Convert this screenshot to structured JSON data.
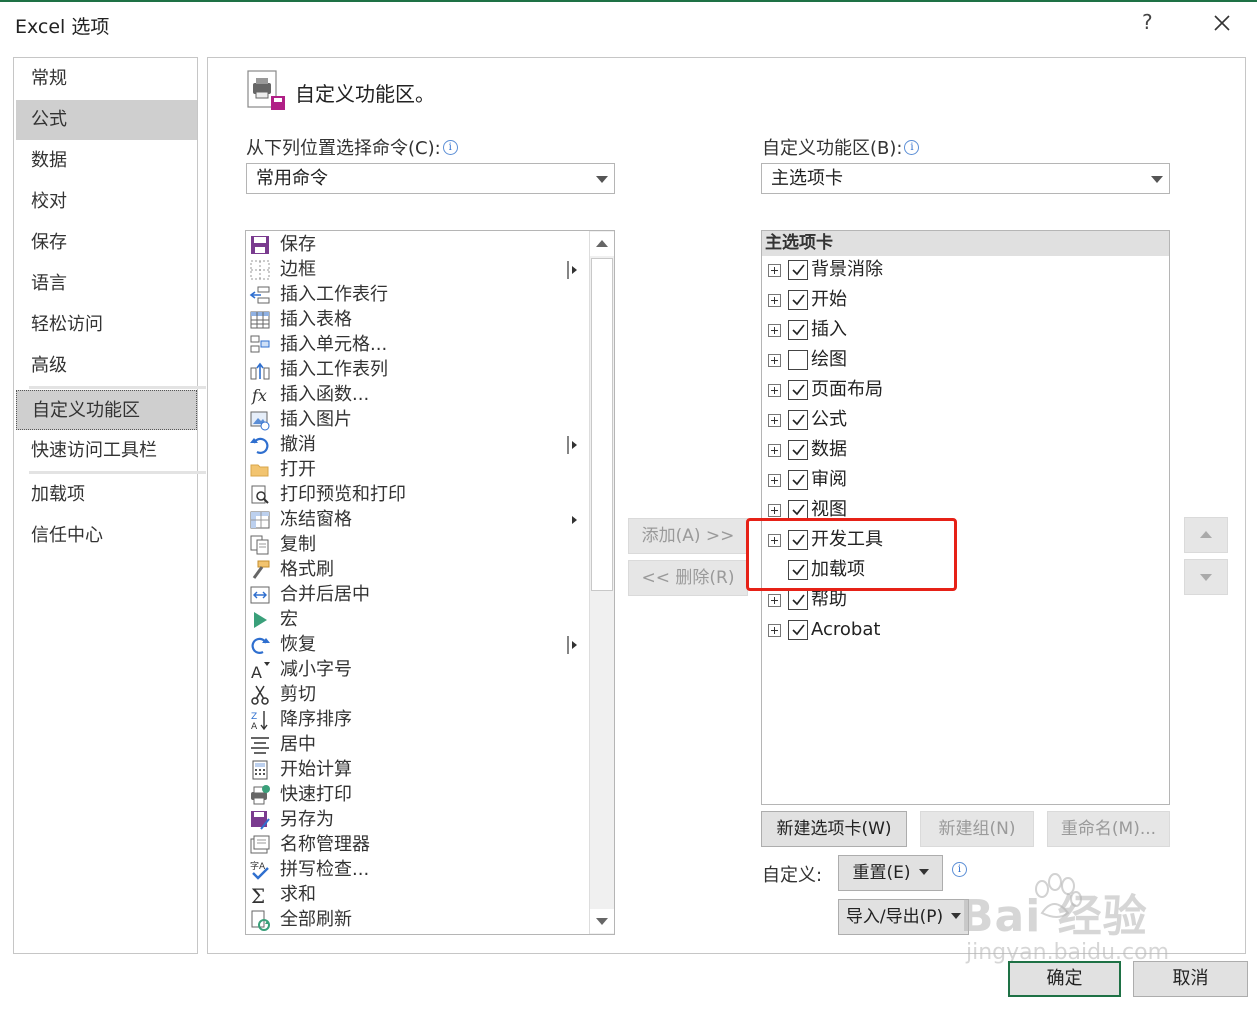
{
  "window": {
    "title": "Excel 选项",
    "help": "?"
  },
  "sidebar": {
    "items": [
      {
        "label": "常规"
      },
      {
        "label": "公式"
      },
      {
        "label": "数据"
      },
      {
        "label": "校对"
      },
      {
        "label": "保存"
      },
      {
        "label": "语言"
      },
      {
        "label": "轻松访问"
      },
      {
        "label": "高级"
      },
      {
        "label": "自定义功能区"
      },
      {
        "label": "快速访问工具栏"
      },
      {
        "label": "加载项"
      },
      {
        "label": "信任中心"
      }
    ]
  },
  "header": {
    "title": "自定义功能区。",
    "icon": "customize-ribbon-icon"
  },
  "left_panel": {
    "choose_label": "从下列位置选择命令(C):",
    "choose_value": "常用命令",
    "commands": [
      {
        "label": "保存",
        "icon": "save-icon"
      },
      {
        "label": "边框",
        "icon": "borders-icon",
        "submenu": "split"
      },
      {
        "label": "插入工作表行",
        "icon": "insert-sheet-rows-icon"
      },
      {
        "label": "插入表格",
        "icon": "insert-table-icon"
      },
      {
        "label": "插入单元格...",
        "icon": "insert-cells-icon"
      },
      {
        "label": "插入工作表列",
        "icon": "insert-sheet-columns-icon"
      },
      {
        "label": "插入函数...",
        "icon": "insert-function-icon"
      },
      {
        "label": "插入图片",
        "icon": "insert-picture-icon"
      },
      {
        "label": "撤消",
        "icon": "undo-icon",
        "submenu": "split"
      },
      {
        "label": "打开",
        "icon": "open-folder-icon"
      },
      {
        "label": "打印预览和打印",
        "icon": "print-preview-icon"
      },
      {
        "label": "冻结窗格",
        "icon": "freeze-panes-icon",
        "submenu": "arrow"
      },
      {
        "label": "复制",
        "icon": "copy-icon"
      },
      {
        "label": "格式刷",
        "icon": "format-painter-icon"
      },
      {
        "label": "合并后居中",
        "icon": "merge-center-icon"
      },
      {
        "label": "宏",
        "icon": "macro-icon"
      },
      {
        "label": "恢复",
        "icon": "redo-icon",
        "submenu": "split"
      },
      {
        "label": "减小字号",
        "icon": "decrease-font-icon"
      },
      {
        "label": "剪切",
        "icon": "cut-icon"
      },
      {
        "label": "降序排序",
        "icon": "sort-descending-icon"
      },
      {
        "label": "居中",
        "icon": "center-align-icon"
      },
      {
        "label": "开始计算",
        "icon": "calculate-icon"
      },
      {
        "label": "快速打印",
        "icon": "quick-print-icon"
      },
      {
        "label": "另存为",
        "icon": "save-as-icon"
      },
      {
        "label": "名称管理器",
        "icon": "name-manager-icon"
      },
      {
        "label": "拼写检查...",
        "icon": "spelling-icon"
      },
      {
        "label": "求和",
        "icon": "sum-icon"
      },
      {
        "label": "全部刷新",
        "icon": "refresh-all-icon"
      }
    ]
  },
  "middle": {
    "add_label": "添加(A) >>",
    "remove_label": "<< 删除(R)"
  },
  "right_panel": {
    "customize_label": "自定义功能区(B):",
    "customize_value": "主选项卡",
    "tree_header": "主选项卡",
    "tabs": [
      {
        "label": "背景消除",
        "checked": true,
        "expander": true
      },
      {
        "label": "开始",
        "checked": true,
        "expander": true
      },
      {
        "label": "插入",
        "checked": true,
        "expander": true
      },
      {
        "label": "绘图",
        "checked": false,
        "expander": true
      },
      {
        "label": "页面布局",
        "checked": true,
        "expander": true
      },
      {
        "label": "公式",
        "checked": true,
        "expander": true
      },
      {
        "label": "数据",
        "checked": true,
        "expander": true
      },
      {
        "label": "审阅",
        "checked": true,
        "expander": true
      },
      {
        "label": "视图",
        "checked": true,
        "expander": true
      },
      {
        "label": "开发工具",
        "checked": true,
        "expander": true
      },
      {
        "label": "加载项",
        "checked": true,
        "expander": false
      },
      {
        "label": "帮助",
        "checked": true,
        "expander": true
      },
      {
        "label": "Acrobat",
        "checked": true,
        "expander": true
      }
    ],
    "new_tab_label": "新建选项卡(W)",
    "new_group_label": "新建组(N)",
    "rename_label": "重命名(M)...",
    "customize_prefix": "自定义:",
    "reset_label": "重置(E)",
    "import_export_label": "导入/导出(P)"
  },
  "footer": {
    "ok_label": "确定",
    "cancel_label": "取消"
  },
  "watermark": {
    "brand": "Bai 经验",
    "url": "jingyan.baidu.com"
  },
  "colors": {
    "highlight_box": "#e62117",
    "accent": "#1e7145"
  }
}
